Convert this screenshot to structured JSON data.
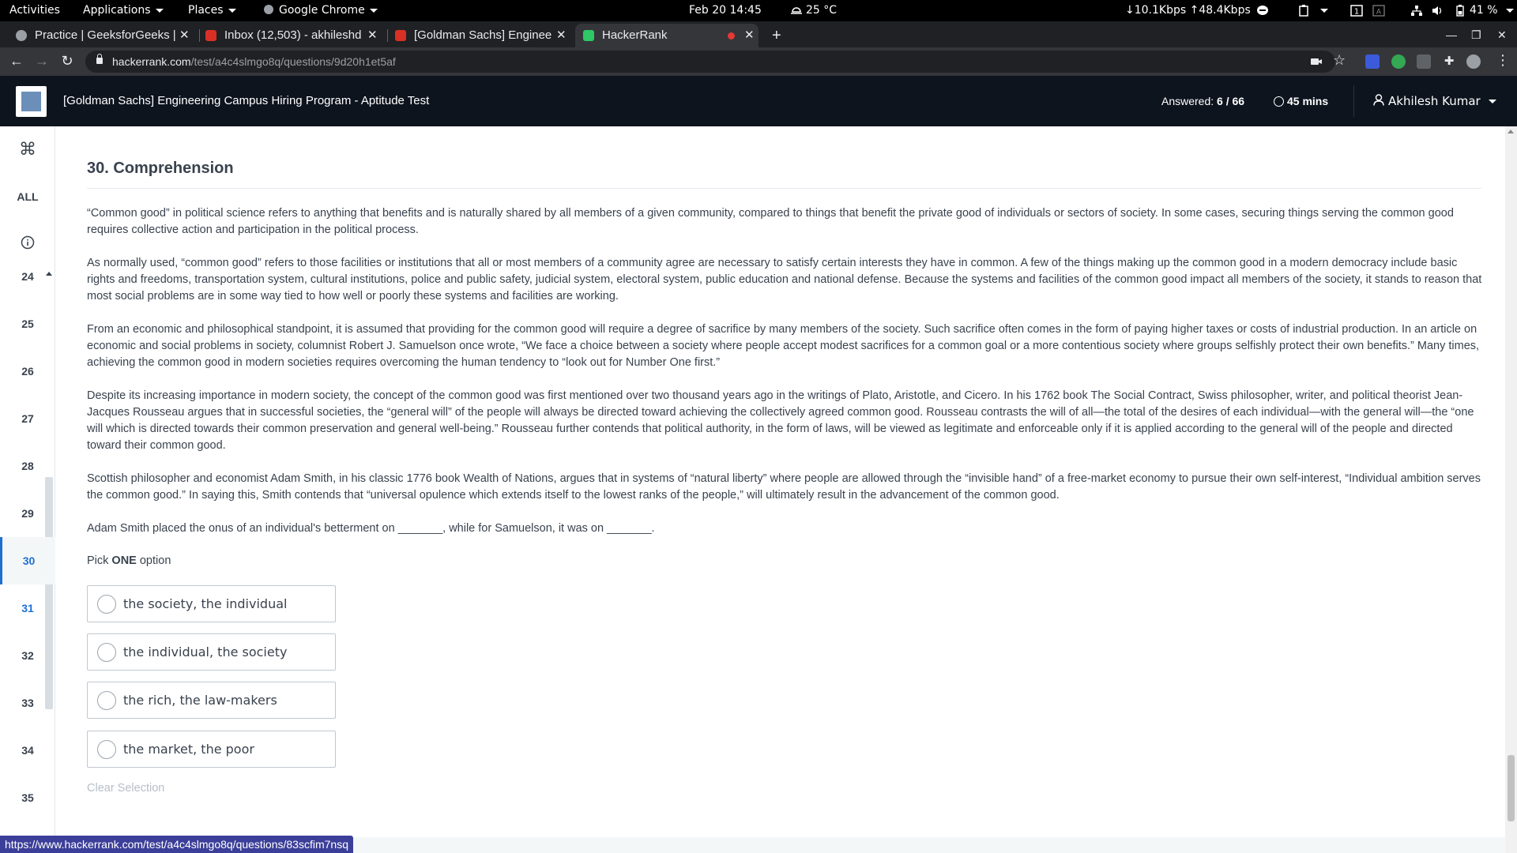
{
  "topbar": {
    "activities": "Activities",
    "applications": "Applications",
    "places": "Places",
    "app_name": "Google Chrome",
    "datetime": "Feb 20  14:45",
    "weather": "25 °C",
    "network": "↓10.1Kbps ↑48.4Kbps",
    "battery": "41 %"
  },
  "tabs": [
    {
      "label": "Practice | GeeksforGeeks |",
      "color": "#9aa0a6"
    },
    {
      "label": "Inbox (12,503) - akhileshd",
      "color": "#d93025"
    },
    {
      "label": "[Goldman Sachs] Enginee",
      "color": "#d93025"
    },
    {
      "label": "HackerRank",
      "color": "#2ec866"
    }
  ],
  "address": {
    "host": "hackerrank.com",
    "path": "/test/a4c4slmgo8q/questions/9d20h1et5af"
  },
  "header": {
    "title": "[Goldman Sachs] Engineering Campus Hiring Program - Aptitude Test",
    "answered_label": "Answered:",
    "answered_value": "6 / 66",
    "timer": "45 mins",
    "user": "Akhilesh Kumar"
  },
  "qnav": {
    "all_label": "ALL",
    "items": [
      "24",
      "25",
      "26",
      "27",
      "28",
      "29",
      "30",
      "31",
      "32",
      "33",
      "34",
      "35"
    ],
    "current": "30"
  },
  "question": {
    "title": "30. Comprehension",
    "paragraphs": [
      "“Common good” in political science refers to anything that benefits and is naturally shared by all members of a given community, compared to things that benefit the private good of individuals or sectors of society. In some cases, securing things serving the common good requires collective action and participation in the political process.",
      "As normally used, “common good” refers to those facilities or institutions that all or most members of a community agree are necessary to satisfy certain interests they have in common. A few of the things making up the common good in a modern democracy include basic rights and freedoms, transportation system, cultural institutions, police and public safety, judicial system, electoral system, public education and national defense. Because the systems and facilities of the common good impact all members of the society, it stands to reason that most social problems are in some way tied to how well or poorly these systems and facilities are working.",
      "From an economic and philosophical standpoint, it is assumed that providing for the common good will require a degree of sacrifice by many members of the society. Such sacrifice often comes in the form of paying higher taxes or costs of industrial production. In an article on economic and social problems in society, columnist Robert J. Samuelson once wrote, “We face a choice between a society where people accept modest sacrifices for a common goal or a more contentious society where groups selfishly protect their own benefits.” Many times, achieving the common good in modern societies requires overcoming the human tendency to “look out for Number One first.”",
      "Despite its increasing importance in modern society, the concept of the common good was first mentioned over two thousand years ago in the writings of Plato, Aristotle, and Cicero. In his 1762 book The Social Contract, Swiss philosopher, writer, and political theorist Jean-Jacques Rousseau argues that in successful societies, the “general will” of the people will always be directed toward achieving the collectively agreed common good. Rousseau contrasts the will of all—the total of the desires of each individual—with the general will—the “one will which is directed towards their common preservation and general well-being.” Rousseau further contends that political authority, in the form of laws, will be viewed as legitimate and enforceable only if it is applied according to the general will of the people and directed toward their common good.",
      "Scottish philosopher and economist Adam Smith, in his classic 1776 book Wealth of Nations, argues that in systems of “natural liberty” where people are allowed through the “invisible hand” of a free-market economy to pursue their own self-interest, “Individual ambition serves the common good.” In saying this, Smith contends that “universal opulence which extends itself to the lowest ranks of the people,” will ultimately result in the advancement of the common good.",
      "Adam Smith placed the onus of an individual's betterment on _______, while for Samuelson, it was on _______."
    ],
    "pick_prefix": "Pick ",
    "pick_bold": "ONE",
    "pick_suffix": " option",
    "options": [
      "the society, the individual",
      "the individual, the society",
      "the rich, the law-makers",
      "the market, the poor"
    ],
    "clear_label": "Clear Selection"
  },
  "status_url": "https://www.hackerrank.com/test/a4c4slmgo8q/questions/83scfim7nsq",
  "colors": {
    "header_bg": "#0e141e",
    "accent": "#1f6fd0",
    "status_bar": "#3c3f99"
  }
}
